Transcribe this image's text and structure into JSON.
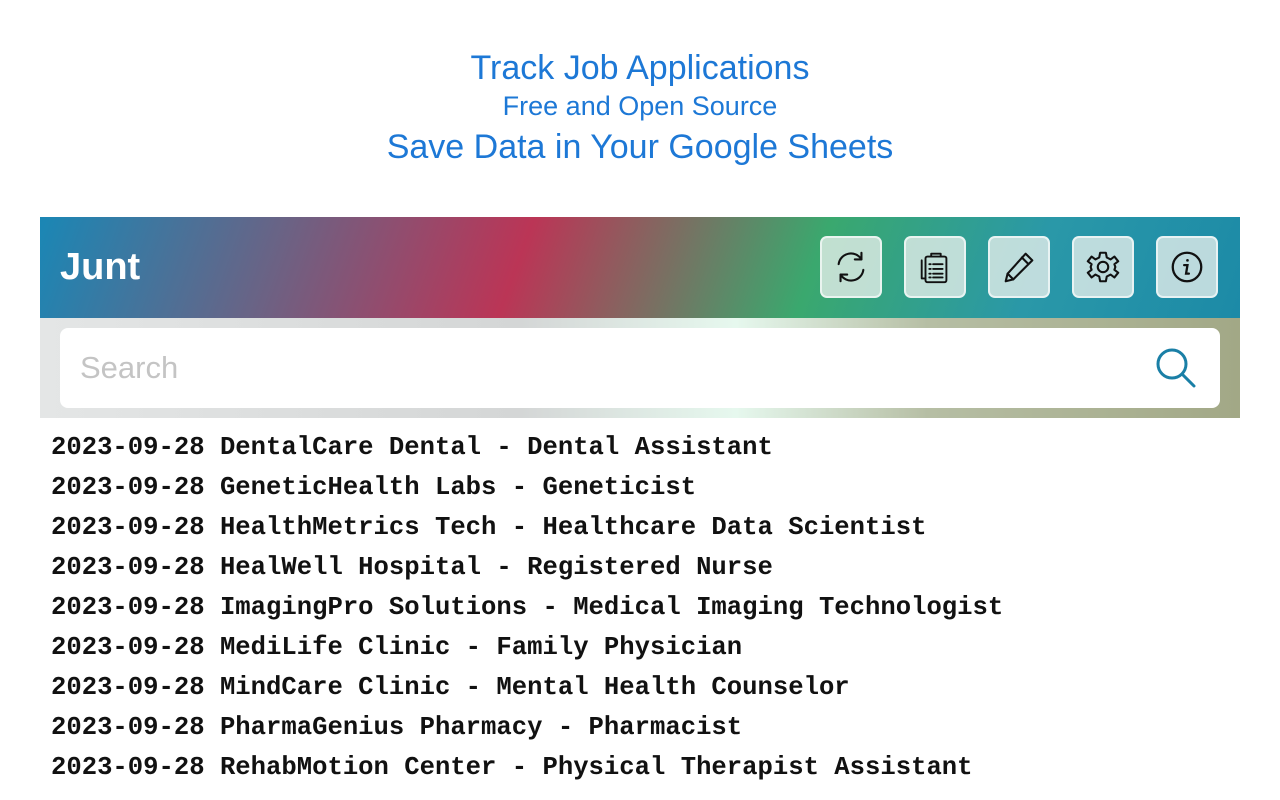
{
  "hero": {
    "title": "Track Job Applications",
    "subtitle": "Free and Open Source",
    "tagline": "Save Data in Your Google Sheets",
    "color": "#1d78d6"
  },
  "app": {
    "title": "Junt",
    "toolbar": [
      {
        "icon": "refresh-icon"
      },
      {
        "icon": "clipboard-list-icon"
      },
      {
        "icon": "pencil-icon"
      },
      {
        "icon": "gear-icon"
      },
      {
        "icon": "info-icon"
      }
    ]
  },
  "search": {
    "placeholder": "Search",
    "value": "",
    "icon": "search-icon",
    "icon_color": "#1a7fa6"
  },
  "jobs": [
    "2023-09-28 DentalCare Dental - Dental Assistant",
    "2023-09-28 GeneticHealth Labs - Geneticist",
    "2023-09-28 HealthMetrics Tech - Healthcare Data Scientist",
    "2023-09-28 HealWell Hospital - Registered Nurse",
    "2023-09-28 ImagingPro Solutions - Medical Imaging Technologist",
    "2023-09-28 MediLife Clinic - Family Physician",
    "2023-09-28 MindCare Clinic - Mental Health Counselor",
    "2023-09-28 PharmaGenius Pharmacy - Pharmacist",
    "2023-09-28 RehabMotion Center - Physical Therapist Assistant"
  ]
}
